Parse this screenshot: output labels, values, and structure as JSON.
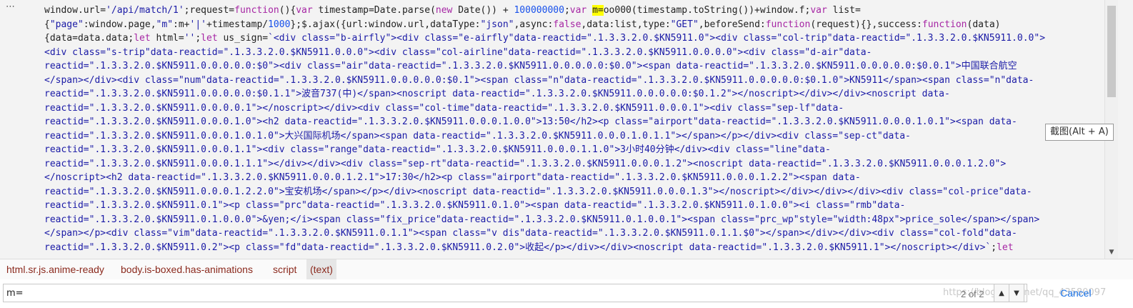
{
  "code_lines": [
    [
      [
        "p",
        "window.url="
      ],
      [
        "s",
        "'/api/match/1'"
      ],
      [
        "p",
        ";request="
      ],
      [
        "k",
        "function"
      ],
      [
        "p",
        "(){"
      ],
      [
        "k",
        "var"
      ],
      [
        "p",
        " timestamp=Date.parse("
      ],
      [
        "k",
        "new"
      ],
      [
        "p",
        " Date()) + "
      ],
      [
        "n",
        "100000000"
      ],
      [
        "p",
        ";"
      ],
      [
        "k",
        "var"
      ],
      [
        "p",
        " "
      ],
      [
        "h",
        "m="
      ],
      [
        "p",
        "oo000(timestamp.toString())+window.f;"
      ],
      [
        "k",
        "var"
      ],
      [
        "p",
        " list="
      ]
    ],
    [
      [
        "p",
        "{"
      ],
      [
        "s",
        "\"page\""
      ],
      [
        "p",
        ":window.page,"
      ],
      [
        "s",
        "\"m\""
      ],
      [
        "p",
        ":m+"
      ],
      [
        "s",
        "'|'"
      ],
      [
        "p",
        "+timestamp/"
      ],
      [
        "n",
        "1000"
      ],
      [
        "p",
        "};$.ajax({url:window.url,dataType:"
      ],
      [
        "s",
        "\"json\""
      ],
      [
        "p",
        ",async:"
      ],
      [
        "k",
        "false"
      ],
      [
        "p",
        ",data:list,type:"
      ],
      [
        "s",
        "\"GET\""
      ],
      [
        "p",
        ",beforeSend:"
      ],
      [
        "k",
        "function"
      ],
      [
        "p",
        "(request){},success:"
      ],
      [
        "k",
        "function"
      ],
      [
        "p",
        "(data)"
      ]
    ],
    [
      [
        "p",
        "{data=data.data;"
      ],
      [
        "k",
        "let"
      ],
      [
        "p",
        " html="
      ],
      [
        "s",
        "''"
      ],
      [
        "p",
        ";"
      ],
      [
        "k",
        "let"
      ],
      [
        "p",
        " us_sign="
      ],
      [
        "s",
        "`<div class=\"b-airfly\"><div class=\"e-airfly\"data-reactid=\".1.3.3.2.0.$KN5911.0\"><div class=\"col-trip\"data-reactid=\".1.3.3.2.0.$KN5911.0.0\">"
      ]
    ],
    [
      [
        "s",
        "<div class=\"s-trip\"data-reactid=\".1.3.3.2.0.$KN5911.0.0.0\"><div class=\"col-airline\"data-reactid=\".1.3.3.2.0.$KN5911.0.0.0.0\"><div class=\"d-air\"data-"
      ]
    ],
    [
      [
        "s",
        "reactid=\".1.3.3.2.0.$KN5911.0.0.0.0.0:$0\"><div class=\"air\"data-reactid=\".1.3.3.2.0.$KN5911.0.0.0.0.0:$0.0\"><span data-reactid=\".1.3.3.2.0.$KN5911.0.0.0.0.0:$0.0.1\">中国联合航空"
      ]
    ],
    [
      [
        "s",
        "</span></div><div class=\"num\"data-reactid=\".1.3.3.2.0.$KN5911.0.0.0.0.0:$0.1\"><span class=\"n\"data-reactid=\".1.3.3.2.0.$KN5911.0.0.0.0.0:$0.1.0\">KN5911</span><span class=\"n\"data-"
      ]
    ],
    [
      [
        "s",
        "reactid=\".1.3.3.2.0.$KN5911.0.0.0.0.0:$0.1.1\">波音737(中)</span><noscript data-reactid=\".1.3.3.2.0.$KN5911.0.0.0.0.0:$0.1.2\"></noscript></div></div><noscript data-"
      ]
    ],
    [
      [
        "s",
        "reactid=\".1.3.3.2.0.$KN5911.0.0.0.0.1\"></noscript></div><div class=\"col-time\"data-reactid=\".1.3.3.2.0.$KN5911.0.0.0.1\"><div class=\"sep-lf\"data-"
      ]
    ],
    [
      [
        "s",
        "reactid=\".1.3.3.2.0.$KN5911.0.0.0.1.0\"><h2 data-reactid=\".1.3.3.2.0.$KN5911.0.0.0.1.0.0\">13:50</h2><p class=\"airport\"data-reactid=\".1.3.3.2.0.$KN5911.0.0.0.1.0.1\"><span data-"
      ]
    ],
    [
      [
        "s",
        "reactid=\".1.3.3.2.0.$KN5911.0.0.0.1.0.1.0\">大兴国际机场</span><span data-reactid=\".1.3.3.2.0.$KN5911.0.0.0.1.0.1.1\"></span></p></div><div class=\"sep-ct\"data-"
      ]
    ],
    [
      [
        "s",
        "reactid=\".1.3.3.2.0.$KN5911.0.0.0.1.1\"><div class=\"range\"data-reactid=\".1.3.3.2.0.$KN5911.0.0.0.1.1.0\">3小时40分钟</div><div class=\"line\"data-"
      ]
    ],
    [
      [
        "s",
        "reactid=\".1.3.3.2.0.$KN5911.0.0.0.1.1.1\"></div></div><div class=\"sep-rt\"data-reactid=\".1.3.3.2.0.$KN5911.0.0.0.1.2\"><noscript data-reactid=\".1.3.3.2.0.$KN5911.0.0.0.1.2.0\">"
      ]
    ],
    [
      [
        "s",
        "</noscript><h2 data-reactid=\".1.3.3.2.0.$KN5911.0.0.0.1.2.1\">17:30</h2><p class=\"airport\"data-reactid=\".1.3.3.2.0.$KN5911.0.0.0.1.2.2\"><span data-"
      ]
    ],
    [
      [
        "s",
        "reactid=\".1.3.3.2.0.$KN5911.0.0.0.1.2.2.0\">宝安机场</span></p></div><noscript data-reactid=\".1.3.3.2.0.$KN5911.0.0.0.1.3\"></noscript></div></div></div><div class=\"col-price\"data-"
      ]
    ],
    [
      [
        "s",
        "reactid=\".1.3.3.2.0.$KN5911.0.1\"><p class=\"prc\"data-reactid=\".1.3.3.2.0.$KN5911.0.1.0\"><span data-reactid=\".1.3.3.2.0.$KN5911.0.1.0.0\"><i class=\"rmb\"data-"
      ]
    ],
    [
      [
        "s",
        "reactid=\".1.3.3.2.0.$KN5911.0.1.0.0.0\">&yen;</i><span class=\"fix_price\"data-reactid=\".1.3.3.2.0.$KN5911.0.1.0.0.1\"><span class=\"prc_wp\"style=\"width:48px\">price_sole</span></span>"
      ]
    ],
    [
      [
        "s",
        "</span></p><div class=\"vim\"data-reactid=\".1.3.3.2.0.$KN5911.0.1.1\"><span class=\"v dis\"data-reactid=\".1.3.3.2.0.$KN5911.0.1.1.$0\"></span></div></div><div class=\"col-fold\"data-"
      ]
    ],
    [
      [
        "s",
        "reactid=\".1.3.3.2.0.$KN5911.0.2\"><p class=\"fd\"data-reactid=\".1.3.3.2.0.$KN5911.0.2.0\">收起</p></div></div><noscript data-reactid=\".1.3.3.2.0.$KN5911.1\"></noscript></div>`"
      ],
      [
        "p",
        ";"
      ],
      [
        "k",
        "let"
      ]
    ]
  ],
  "ellipsis": "⋯",
  "tooltip": "截图(Alt + A)",
  "breadcrumbs": [
    "html.sr.js.anime-ready",
    "body.is-boxed.has-animations",
    "script",
    "(text)"
  ],
  "find": {
    "value": "m=",
    "match_count": "2 of 2",
    "cancel_label": "Cancel",
    "watermark": "https://blog.csdn.net/qq_43580097"
  },
  "icons": {
    "prev": "▲",
    "next": "▼",
    "scroll_down": "▼"
  },
  "colors": {
    "keyword": "#a626a4",
    "string": "#1a1aa6",
    "number": "#1750eb",
    "highlight": "#ffff00",
    "crumb": "#8b2a1e",
    "cancel": "#1a73e8"
  }
}
